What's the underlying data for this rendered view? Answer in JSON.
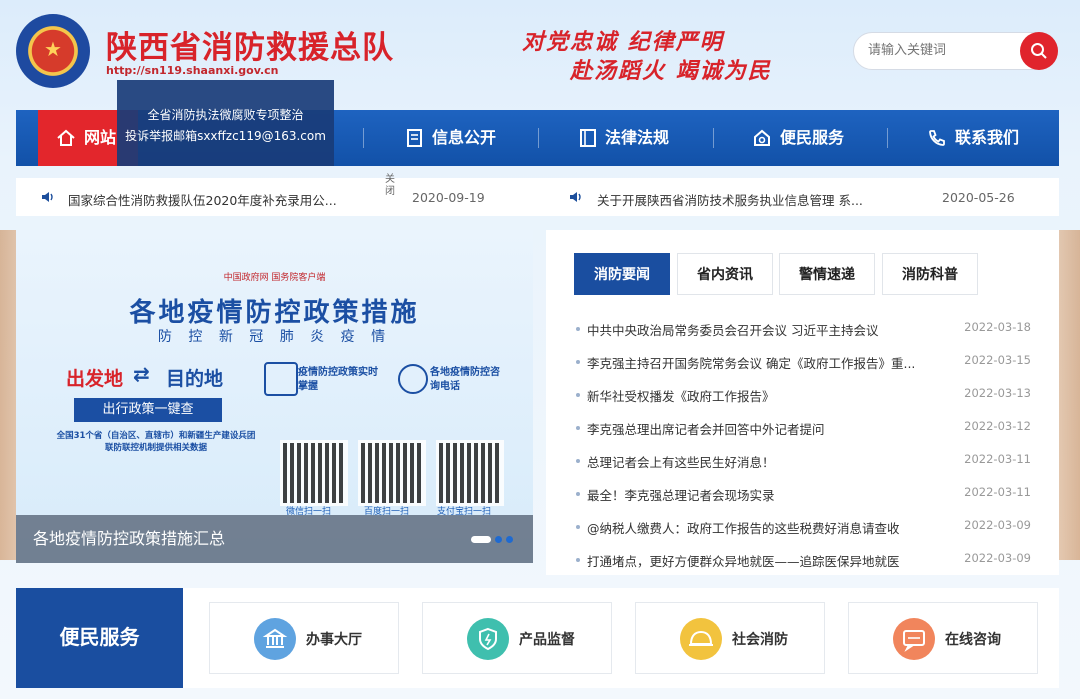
{
  "header": {
    "title": "陕西省消防救援总队",
    "url": "http://sn119.shaanxi.gov.cn",
    "slogan_line1": "对党忠诚 纪律严明",
    "slogan_line2": "赴汤蹈火 竭诚为民",
    "search_placeholder": "请输入关键词",
    "colors": {
      "brand_red": "#d8232a",
      "nav_blue": "#1a56ae"
    }
  },
  "nav": {
    "items": [
      {
        "label": "网站首页",
        "icon": "home-icon"
      },
      {
        "label": "信息公开",
        "icon": "document-icon"
      },
      {
        "label": "法律法规",
        "icon": "book-icon"
      },
      {
        "label": "便民服务",
        "icon": "service-icon"
      },
      {
        "label": "联系我们",
        "icon": "phone-icon"
      }
    ],
    "home_visible": "网站"
  },
  "popup": {
    "line1": "全省消防执法微腐败专项整治",
    "line2": "投诉举报邮箱sxxffzc119@163.com",
    "close": "关闭"
  },
  "notices": [
    {
      "text": "国家综合性消防救援队伍2020年度补充录用公...",
      "date": "2020-09-19"
    },
    {
      "text": "关于开展陕西省消防技术服务执业信息管理 系...",
      "date": "2020-05-26"
    }
  ],
  "banner": {
    "top_logos": "中国政府网   国务院客户端",
    "title": "各地疫情防控政策措施",
    "subtitle": "防 控 新 冠 肺 炎 疫 情",
    "from_to_a": "出发地",
    "from_to_b": "目的地",
    "query_button": "出行政策一键查",
    "feature1": "疫情防控政策实时掌握",
    "feature2": "各地疫情防控咨询电话",
    "note": "全国31个省（自治区、直辖市）和新疆生产建设兵团联防联控机制提供相关数据",
    "qr_labels": [
      "微信扫一扫",
      "百度扫一扫",
      "支付宝扫一扫"
    ],
    "caption": "各地疫情防控政策措施汇总"
  },
  "news": {
    "tabs": [
      "消防要闻",
      "省内资讯",
      "警情速递",
      "消防科普"
    ],
    "rows": [
      {
        "title": "中共中央政治局常务委员会召开会议 习近平主持会议",
        "date": "2022-03-18"
      },
      {
        "title": "李克强主持召开国务院常务会议 确定《政府工作报告》重...",
        "date": "2022-03-15"
      },
      {
        "title": "新华社受权播发《政府工作报告》",
        "date": "2022-03-13"
      },
      {
        "title": "李克强总理出席记者会并回答中外记者提问",
        "date": "2022-03-12"
      },
      {
        "title": "总理记者会上有这些民生好消息！",
        "date": "2022-03-11"
      },
      {
        "title": "最全！李克强总理记者会现场实录",
        "date": "2022-03-11"
      },
      {
        "title": "@纳税人缴费人：政府工作报告的这些税费好消息请查收",
        "date": "2022-03-09"
      },
      {
        "title": "打通堵点，更好方便群众异地就医——追踪医保异地就医",
        "date": "2022-03-09"
      }
    ]
  },
  "services": {
    "heading": "便民服务",
    "cards": [
      {
        "label": "办事大厅",
        "icon": "bank-icon",
        "color": "#5fa3e0"
      },
      {
        "label": "产品监督",
        "icon": "shield-icon",
        "color": "#3fbfae"
      },
      {
        "label": "社会消防",
        "icon": "helmet-icon",
        "color": "#f2c33e"
      },
      {
        "label": "在线咨询",
        "icon": "chat-icon",
        "color": "#f1855c"
      }
    ]
  }
}
